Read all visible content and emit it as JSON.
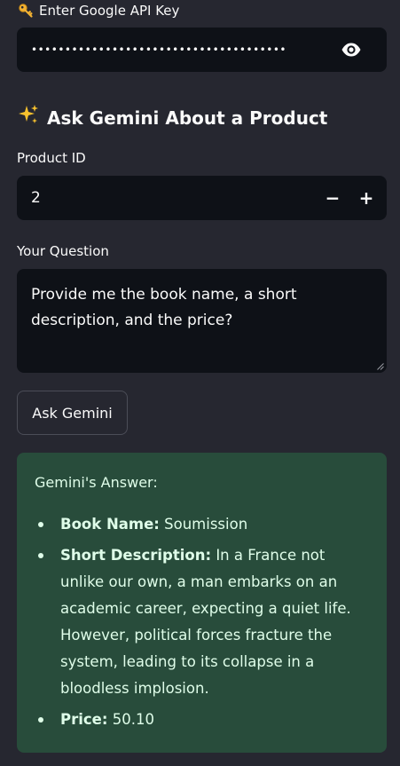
{
  "api_key": {
    "label": "Enter Google API Key",
    "label_icon": "key-icon",
    "masked_value": "••••••••••••••••••••••••••••••••••••••",
    "toggle_icon": "eye-icon"
  },
  "section": {
    "icon": "sparkles-icon",
    "title": "Ask Gemini About a Product"
  },
  "product": {
    "label": "Product ID",
    "value": "2",
    "decrement_label": "−",
    "increment_label": "+"
  },
  "question": {
    "label": "Your Question",
    "value": "Provide me the book name, a short description, and the price?"
  },
  "ask_button": {
    "label": "Ask Gemini"
  },
  "answer": {
    "title": "Gemini's Answer:",
    "items": [
      {
        "key": "Book Name:",
        "text": "Soumission"
      },
      {
        "key": "Short Description:",
        "text": "In a France not unlike our own, a man embarks on an academic career, expecting a quiet life. However, political forces fracture the system, leading to its collapse in a bloodless implosion."
      },
      {
        "key": "Price:",
        "text": "50.10"
      }
    ]
  },
  "colors": {
    "background": "#262730",
    "input_background": "#0e1117",
    "success_background": "#284c3b",
    "success_text": "#dffde9"
  }
}
